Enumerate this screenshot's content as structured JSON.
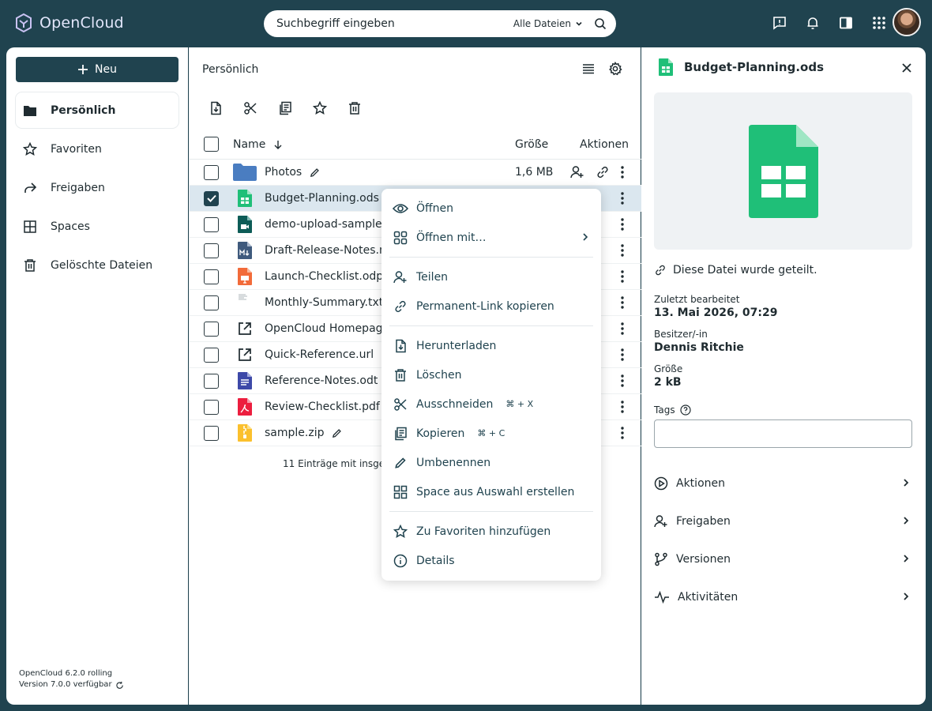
{
  "app": {
    "name": "OpenCloud"
  },
  "search": {
    "placeholder": "Suchbegriff eingeben",
    "scope": "Alle Dateien"
  },
  "sidebar": {
    "new_label": "Neu",
    "items": [
      {
        "label": "Persönlich",
        "icon": "folder-icon",
        "active": true
      },
      {
        "label": "Favoriten",
        "icon": "star-icon"
      },
      {
        "label": "Freigaben",
        "icon": "share-arrow-icon"
      },
      {
        "label": "Spaces",
        "icon": "grid-icon"
      },
      {
        "label": "Gelöschte Dateien",
        "icon": "trash-icon"
      }
    ],
    "version_line1": "OpenCloud 6.2.0 rolling",
    "version_line2": "Version 7.0.0 verfügbar"
  },
  "main": {
    "breadcrumb": "Persönlich",
    "columns": {
      "name": "Name",
      "size": "Größe",
      "actions": "Aktionen"
    },
    "files": [
      {
        "name": "Photos",
        "size": "1,6 MB",
        "type": "folder"
      },
      {
        "name": "Budget-Planning.ods",
        "size": "",
        "type": "spreadsheet",
        "selected": true
      },
      {
        "name": "demo-upload-sample",
        "size": "",
        "type": "video"
      },
      {
        "name": "Draft-Release-Notes.m",
        "size": "",
        "type": "markdown"
      },
      {
        "name": "Launch-Checklist.odp",
        "size": "",
        "type": "presentation"
      },
      {
        "name": "Monthly-Summary.txt",
        "size": "",
        "type": "text"
      },
      {
        "name": "OpenCloud Homepag",
        "size": "",
        "type": "link"
      },
      {
        "name": "Quick-Reference.url",
        "size": "",
        "type": "link"
      },
      {
        "name": "Reference-Notes.odt",
        "size": "",
        "type": "document"
      },
      {
        "name": "Review-Checklist.pdf",
        "size": "",
        "type": "pdf"
      },
      {
        "name": "sample.zip",
        "size": "",
        "type": "zip"
      }
    ],
    "summary": "11 Einträge mit insges"
  },
  "context_menu": {
    "items": [
      {
        "label": "Öffnen"
      },
      {
        "label": "Öffnen mit…"
      },
      {
        "label": "Teilen"
      },
      {
        "label": "Permanent-Link kopieren"
      },
      {
        "label": "Herunterladen"
      },
      {
        "label": "Löschen"
      },
      {
        "label": "Ausschneiden",
        "shortcut": "⌘ + X"
      },
      {
        "label": "Kopieren",
        "shortcut": "⌘ + C"
      },
      {
        "label": "Umbenennen"
      },
      {
        "label": "Space aus Auswahl erstellen"
      },
      {
        "label": "Zu Favoriten hinzufügen"
      },
      {
        "label": "Details"
      }
    ]
  },
  "panel": {
    "title": "Budget-Planning.ods",
    "shared_note": "Diese Datei wurde geteilt.",
    "last_modified_label": "Zuletzt bearbeitet",
    "last_modified": "13. Mai 2026, 07:29",
    "owner_label": "Besitzer/-in",
    "owner": "Dennis Ritchie",
    "size_label": "Größe",
    "size": "2 kB",
    "tags_label": "Tags",
    "sections": [
      {
        "label": "Aktionen"
      },
      {
        "label": "Freigaben"
      },
      {
        "label": "Versionen"
      },
      {
        "label": "Aktivitäten"
      }
    ]
  },
  "colors": {
    "brand": "#20434f",
    "selected_row": "#dbe7ef",
    "spreadsheet_green": "#1fbf78",
    "folder_blue": "#4a7dc1",
    "logo_purple": "#e2e6fb"
  }
}
